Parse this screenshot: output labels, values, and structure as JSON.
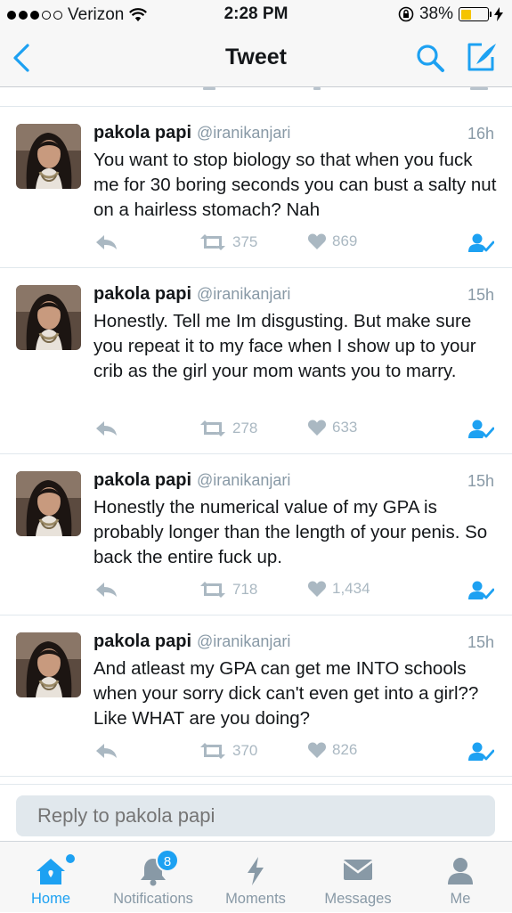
{
  "status_bar": {
    "carrier": "Verizon",
    "time": "2:28 PM",
    "battery": "38%"
  },
  "nav": {
    "title": "Tweet",
    "back_icon": "chevron-left-icon",
    "search_icon": "search-icon",
    "compose_icon": "compose-icon"
  },
  "colors": {
    "accent": "#1da1f2",
    "muted": "#8899a6",
    "action_gray": "#aab8c2"
  },
  "tweets": [
    {
      "name": "pakola papi",
      "handle": "@iranikanjari",
      "time": "16h",
      "text": "You want to stop biology so that when you fuck me for 30 boring seconds you can bust a salty nut on a hairless stomach? Nah",
      "retweets": "375",
      "likes": "869"
    },
    {
      "name": "pakola papi",
      "handle": "@iranikanjari",
      "time": "15h",
      "text": "Honestly. Tell me Im disgusting. But make sure you repeat it to my face when I show up to your crib as the girl your mom wants you to marry.",
      "retweets": "278",
      "likes": "633"
    },
    {
      "name": "pakola papi",
      "handle": "@iranikanjari",
      "time": "15h",
      "text": "Honestly the numerical value of my GPA is probably longer than the length of your penis. So back the entire fuck up.",
      "retweets": "718",
      "likes": "1,434"
    },
    {
      "name": "pakola papi",
      "handle": "@iranikanjari",
      "time": "15h",
      "text": "And atleast my GPA can get me INTO schools when your sorry dick can't even get into a girl?? Like WHAT are you doing?",
      "retweets": "370",
      "likes": "826"
    }
  ],
  "reply": {
    "placeholder": "Reply to pakola papi"
  },
  "tabs": [
    {
      "label": "Home",
      "icon": "home-icon",
      "active": true
    },
    {
      "label": "Notifications",
      "icon": "bell-icon",
      "badge": "8"
    },
    {
      "label": "Moments",
      "icon": "lightning-icon"
    },
    {
      "label": "Messages",
      "icon": "envelope-icon"
    },
    {
      "label": "Me",
      "icon": "person-icon"
    }
  ]
}
